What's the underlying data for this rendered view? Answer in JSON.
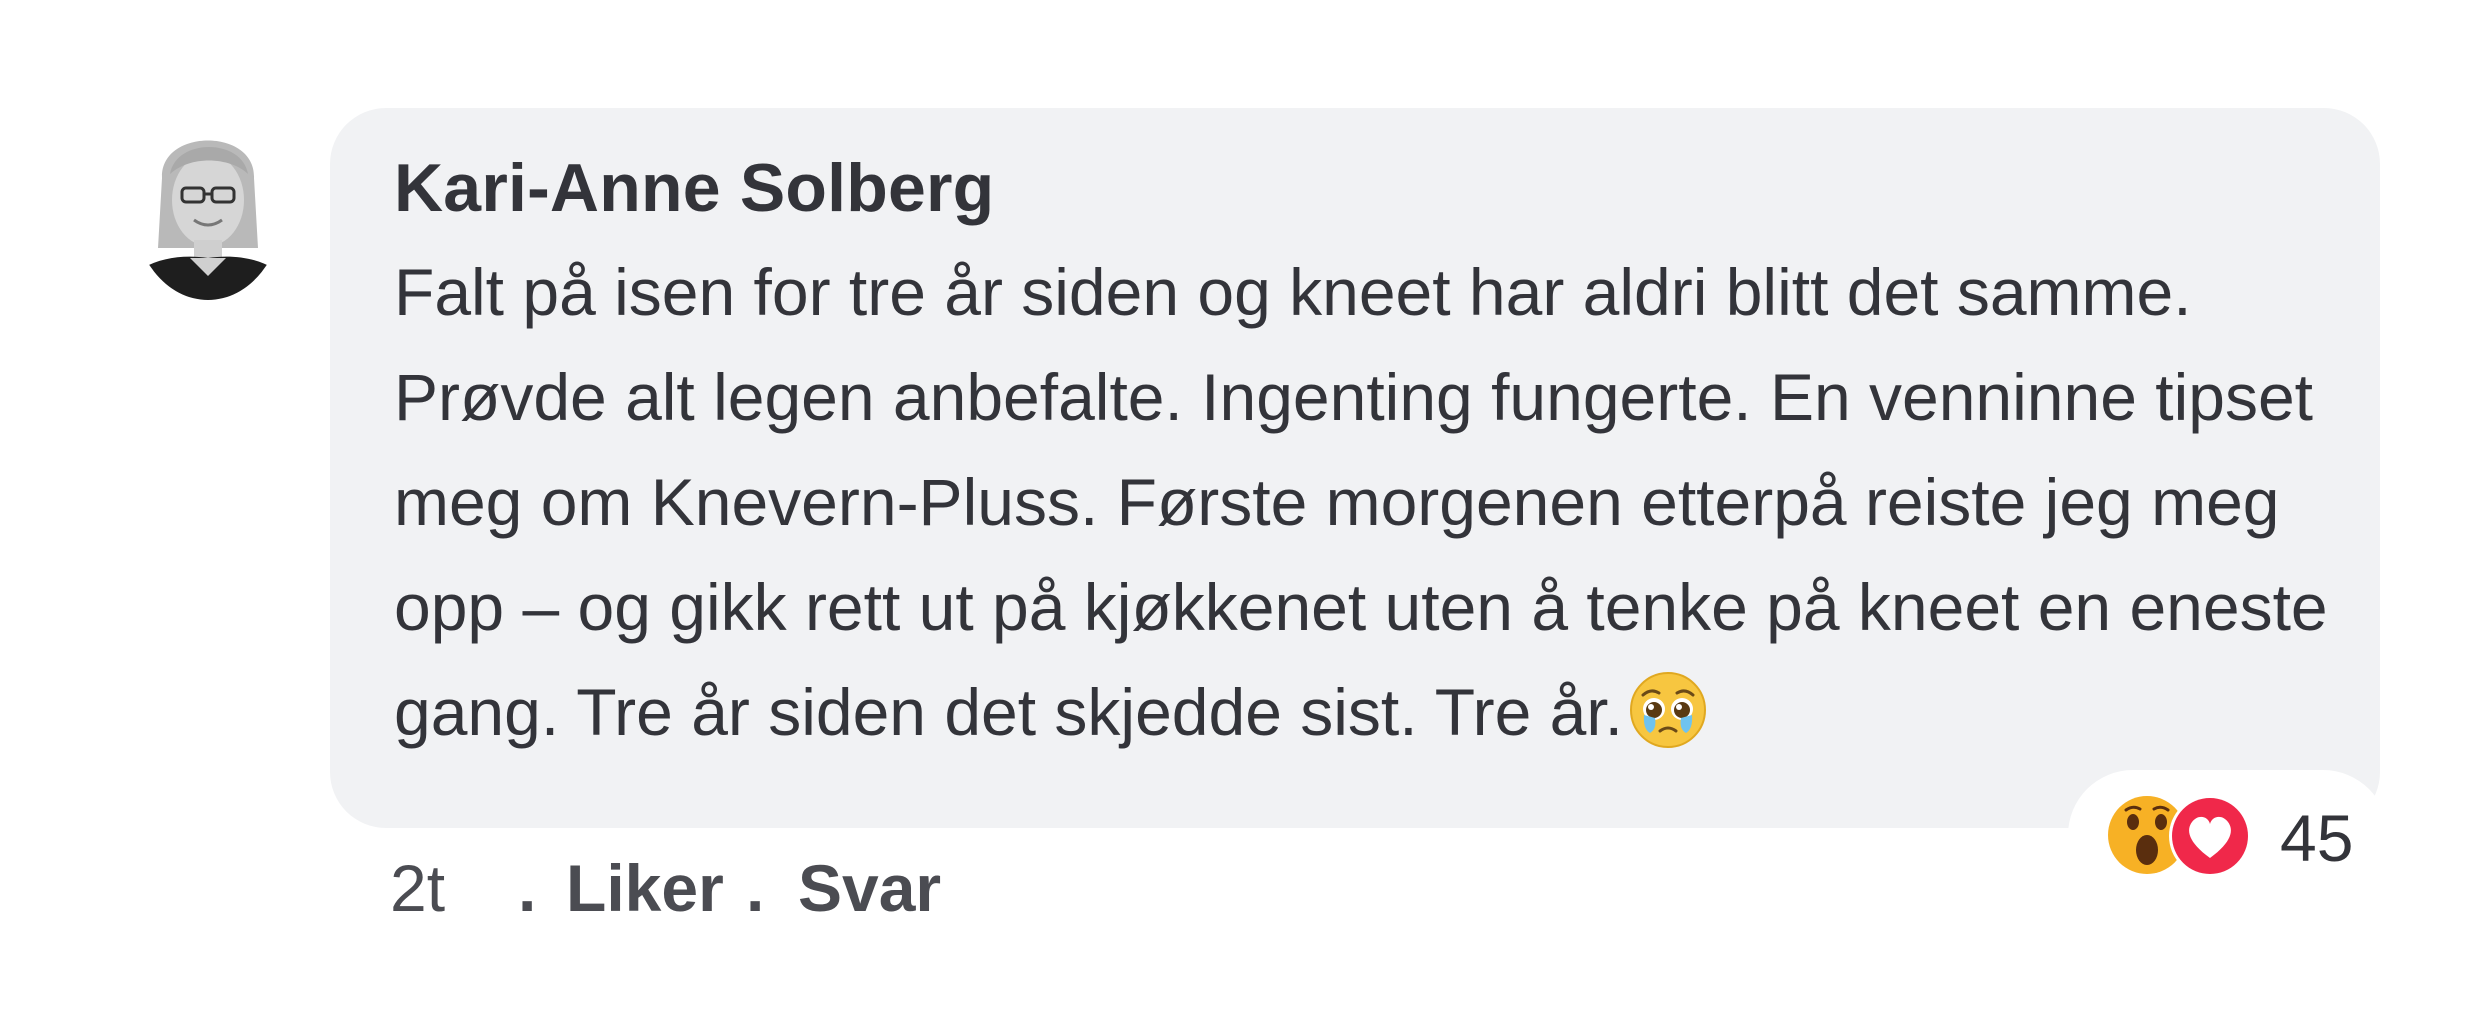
{
  "comment": {
    "author": "Kari-Anne Solberg",
    "text": "Falt på isen for tre år siden og kneet har aldri blitt det samme. Prøvde alt legen anbefalte. Ingenting fungerte. En venninne tipset meg om Knevern-Pluss. Første morgenen etterpå reiste jeg meg opp – og gikk rett ut på kjøkkenet uten å tenke på kneet en eneste gang. Tre år siden det skjedde sist. Tre år.",
    "inline_emoji": "pleading-face-with-tear-icon"
  },
  "reactions": {
    "icons": [
      "wow-icon",
      "love-icon"
    ],
    "count": "45"
  },
  "actions": {
    "time": "2t",
    "separator": ".",
    "like_label": "Liker",
    "reply_label": "Svar"
  },
  "colors": {
    "bubble_bg": "#f1f2f4",
    "text": "#33343a",
    "love_red": "#f0284a",
    "wow_yellow": "#f7b125"
  }
}
